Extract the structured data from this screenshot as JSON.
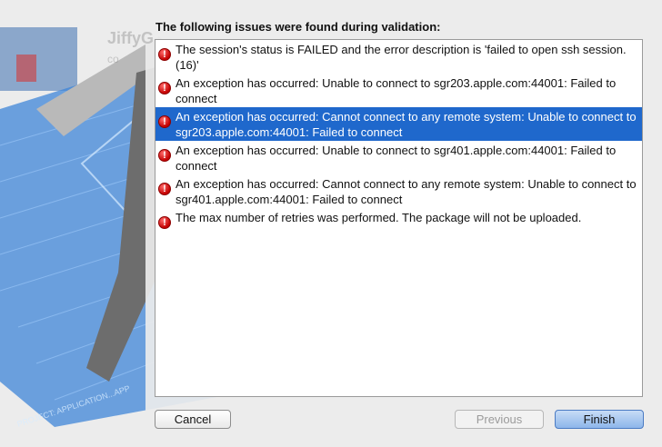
{
  "background": {
    "ghost_title": "JiffyG",
    "ghost_sub": "co",
    "blueprint_footer": "PROJECT: APPLICATION...APP"
  },
  "dialog": {
    "heading": "The following issues were found during validation:",
    "issues": [
      {
        "text": "The session's status is FAILED and the error description is 'failed to open ssh session. (16)'",
        "selected": false
      },
      {
        "text": "An exception has occurred: Unable to connect to sgr203.apple.com:44001: Failed to connect",
        "selected": false
      },
      {
        "text": "An exception has occurred: Cannot connect to any remote system: Unable to connect to sgr203.apple.com:44001: Failed to connect",
        "selected": true
      },
      {
        "text": "An exception has occurred: Unable to connect to sgr401.apple.com:44001: Failed to connect",
        "selected": false
      },
      {
        "text": "An exception has occurred: Cannot connect to any remote system: Unable to connect to sgr401.apple.com:44001: Failed to connect",
        "selected": false
      },
      {
        "text": "The max number of retries was performed. The package will not be uploaded.",
        "selected": false
      }
    ],
    "error_glyph": "!",
    "buttons": {
      "cancel": "Cancel",
      "previous": "Previous",
      "finish": "Finish"
    }
  },
  "colors": {
    "selection": "#1f68cc",
    "error": "#c40000"
  }
}
